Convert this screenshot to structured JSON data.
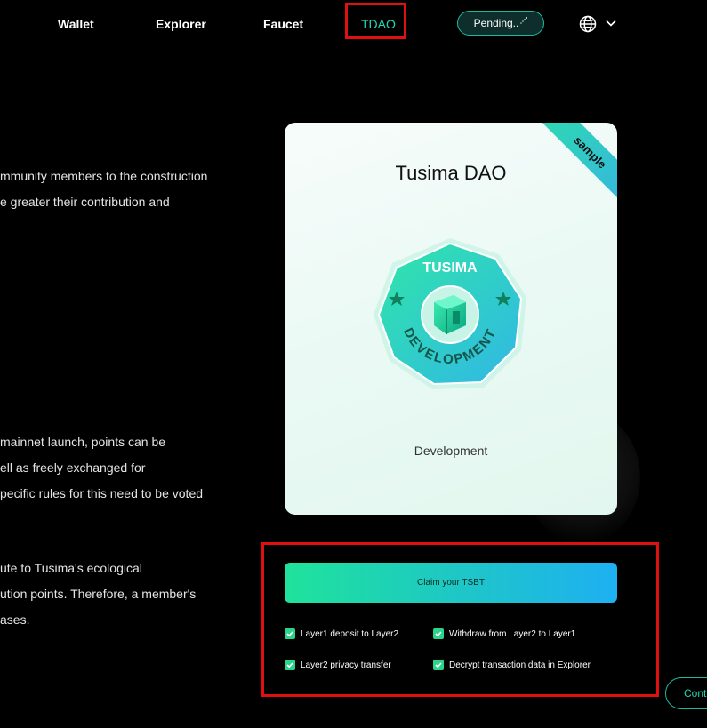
{
  "nav": {
    "items": [
      {
        "label": "Wallet"
      },
      {
        "label": "Explorer"
      },
      {
        "label": "Faucet"
      },
      {
        "label": "TDAO"
      }
    ],
    "pending_label": "Pending..",
    "language_icon": "globe-icon"
  },
  "text_fragments": {
    "p1_line1": "mmunity members to the construction",
    "p1_line2": "e greater their contribution and",
    "p2_line1": "mainnet launch, points can be",
    "p2_line2": "ell as freely exchanged for",
    "p2_line3": "pecific rules for this need to be voted",
    "p3_line1": "ute to Tusima's ecological",
    "p3_line2": "ution points. Therefore, a member's",
    "p3_line3": "ases."
  },
  "card": {
    "title": "Tusima DAO",
    "ribbon": "sample",
    "badge_top": "TUSIMA",
    "badge_bottom": "DEVELOPMENT",
    "subtitle": "Development"
  },
  "claim": {
    "button_label": "Claim your TSBT",
    "tasks": [
      {
        "label": "Layer1 deposit to Layer2",
        "checked": true
      },
      {
        "label": "Withdraw from Layer2 to Layer1",
        "checked": true
      },
      {
        "label": "Layer2 privacy transfer",
        "checked": true
      },
      {
        "label": "Decrypt transaction data in Explorer",
        "checked": true
      }
    ]
  },
  "continue_label": "Conti",
  "colors": {
    "accent": "#20d6b5",
    "highlight_border": "#e01010",
    "background": "#000000"
  }
}
